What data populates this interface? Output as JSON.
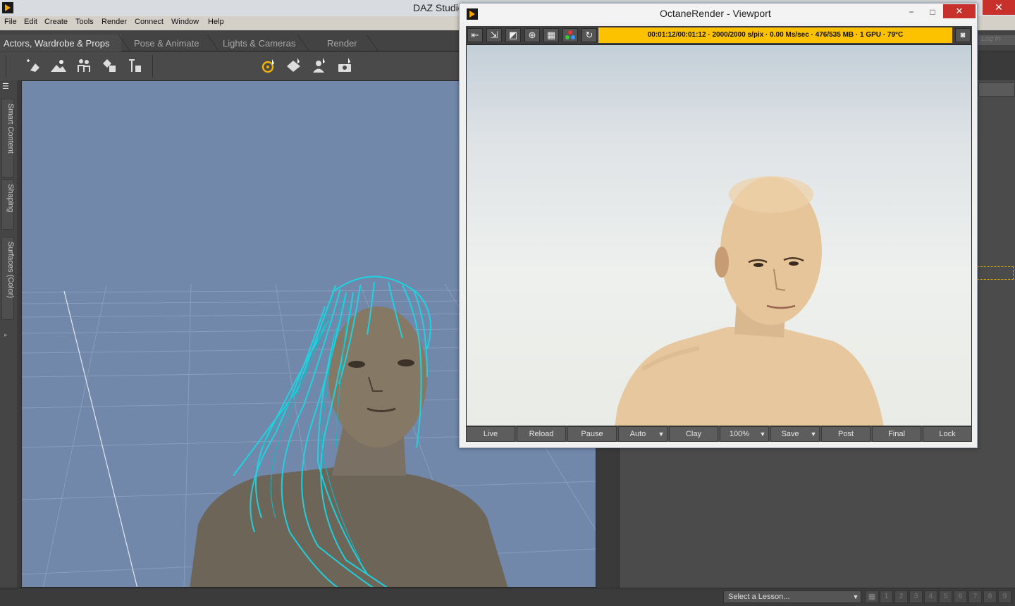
{
  "app": {
    "title": "DAZ Studio",
    "close_glyph": "✕"
  },
  "menu": [
    "File",
    "Edit",
    "Create",
    "Tools",
    "Render",
    "Connect",
    "Window",
    "Help"
  ],
  "tabs": [
    "Actors, Wardrobe & Props",
    "Pose & Animate",
    "Lights & Cameras",
    "Render"
  ],
  "toolbar": {
    "left_icons": [
      "add-actor-icon",
      "environment-icon",
      "people-icon",
      "props-icon",
      "figure-setup-icon"
    ],
    "center_icons": [
      "universal-tool-icon",
      "surface-tool-icon",
      "node-tool-icon",
      "camera-tool-icon"
    ]
  },
  "left_tabs": [
    "Smart Content",
    "Shaping",
    "Surfaces (Color)"
  ],
  "right_panel": {
    "login_placeholder": "Log In"
  },
  "octane": {
    "title": "OctaneRender - Viewport",
    "status": "00:01:12/00:01:12 · 2000/2000 s/pix · 0.00 Ms/sec · 476/535 MB · 1 GPU · 79°C",
    "toolbar_icons": [
      "send-to-octane-icon",
      "import-icon",
      "render-region-icon",
      "focus-picker-icon",
      "grid-icon",
      "material-picker-icon",
      "refresh-icon"
    ],
    "buttons": [
      "Live",
      "Reload",
      "Pause",
      "Auto",
      "Clay",
      "100%",
      "Save",
      "Post",
      "Final",
      "Lock"
    ],
    "window_controls": {
      "minimize": "−",
      "maximize": "□",
      "close": "✕"
    }
  },
  "statusbar": {
    "lesson_placeholder": "Select a Lesson...",
    "steps": [
      "1",
      "2",
      "3",
      "4",
      "5",
      "6",
      "7",
      "8",
      "9"
    ]
  },
  "colors": {
    "viewport_bg": "#7188ab",
    "hair_guide": "#1ad6e4",
    "octane_status": "#fcc200",
    "close_red": "#c7302b"
  }
}
